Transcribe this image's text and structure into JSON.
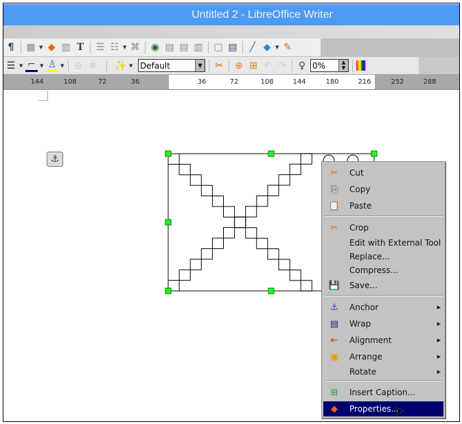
{
  "window": {
    "title": "Untitled 2 - LibreOffice Writer",
    "title_bar_color": "#4d9af3"
  },
  "toolbar1": {
    "icons": [
      "formatting-marks-icon",
      "table-icon",
      "image-icon",
      "chart-icon",
      "fontwork-icon",
      "header-icon",
      "footnote-icon",
      "bookmark-icon",
      "navigator-icon",
      "caption-icon",
      "index-icon",
      "page-number-icon",
      "field-icon",
      "comment-icon",
      "line-icon",
      "shapes-icon",
      "draw-icon"
    ]
  },
  "toolbar2": {
    "style_value": "Default",
    "transparency_value": "0%"
  },
  "ruler": {
    "labels_left": [
      "144",
      "108",
      "72",
      "36"
    ],
    "labels_right": [
      "36",
      "72",
      "108",
      "144",
      "180",
      "216",
      "252",
      "288"
    ]
  },
  "context_menu": {
    "items": [
      {
        "label": "Cut",
        "icon": "scissors-icon"
      },
      {
        "label": "Copy",
        "icon": "copy-icon"
      },
      {
        "label": "Paste",
        "icon": "paste-icon"
      },
      {
        "label": "Crop",
        "icon": "crop-icon"
      },
      {
        "label": "Edit with External Tool",
        "icon": ""
      },
      {
        "label": "Replace...",
        "icon": ""
      },
      {
        "label": "Compress...",
        "icon": ""
      },
      {
        "label": "Save...",
        "icon": "save-icon"
      },
      {
        "label": "Anchor",
        "icon": "anchor-icon",
        "submenu": true
      },
      {
        "label": "Wrap",
        "icon": "wrap-icon",
        "submenu": true
      },
      {
        "label": "Alignment",
        "icon": "alignment-icon",
        "submenu": true
      },
      {
        "label": "Arrange",
        "icon": "arrange-icon",
        "submenu": true
      },
      {
        "label": "Rotate",
        "icon": "",
        "submenu": true
      },
      {
        "label": "Insert Caption...",
        "icon": "insert-caption-icon"
      },
      {
        "label": "Properties...",
        "icon": "properties-icon",
        "highlighted": true
      }
    ],
    "highlight_color": "#00006e"
  }
}
